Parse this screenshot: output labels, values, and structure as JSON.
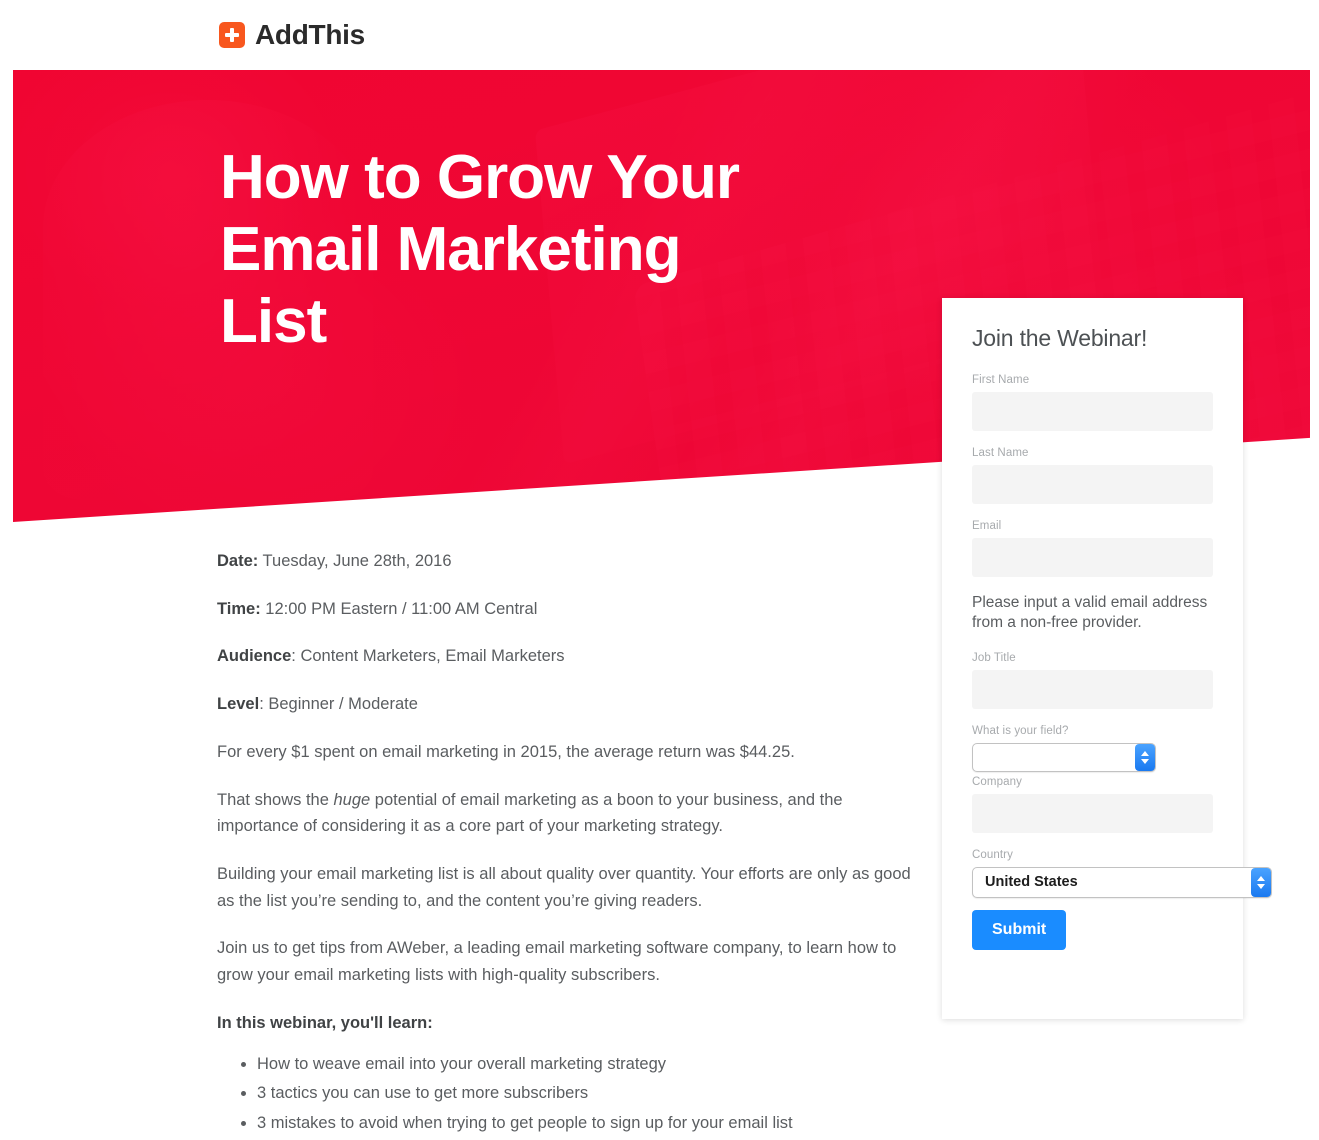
{
  "brand": {
    "name": "AddThis",
    "mark_icon": "addthis-plus-icon",
    "mark_color": "#f8571e"
  },
  "hero": {
    "title": "How to Grow Your\nEmail Marketing\nList",
    "overlay_color": "#ff0844",
    "background_image": "desk-with-laptop-and-drink-photo"
  },
  "article": {
    "meta": [
      {
        "label": "Date:",
        "value": " Tuesday, June 28th, 2016"
      },
      {
        "label": "Time:",
        "value": " 12:00 PM Eastern / 11:00 AM Central"
      },
      {
        "label": "Audience",
        "value": ": Content Marketers, Email Marketers"
      },
      {
        "label": "Level",
        "value": ": Beginner / Moderate"
      }
    ],
    "para_1": "For every $1 spent on email marketing in 2015, the average return was $44.25.",
    "para_2_before": "That shows the ",
    "para_2_em": "huge",
    "para_2_after": " potential of email marketing as a boon to your business, and the importance of considering it as a core part of your marketing strategy.",
    "para_3": "Building your email marketing list is all about quality over quantity. Your efforts are only as good as the list you’re sending to, and the content you’re giving readers.",
    "para_4": "Join us to get tips from AWeber, a leading email marketing software company, to learn how to grow your email marketing lists with high-quality subscribers.",
    "lead_in": "In this webinar, you'll learn:",
    "bullets": [
      "How to weave email into your overall marketing strategy",
      "3 tactics you can use to get more subscribers",
      "3 mistakes to avoid when trying to get people to sign up for your email list"
    ]
  },
  "form": {
    "title": "Join the Webinar!",
    "first_name": {
      "label": "First Name",
      "value": "",
      "placeholder": ""
    },
    "last_name": {
      "label": "Last Name",
      "value": "",
      "placeholder": ""
    },
    "email": {
      "label": "Email",
      "value": "",
      "placeholder": ""
    },
    "email_note": "Please input a valid email address from a non-free provider.",
    "job_title": {
      "label": "Job Title",
      "value": "",
      "placeholder": ""
    },
    "field": {
      "label": "What is your field?",
      "value": ""
    },
    "company": {
      "label": "Company",
      "value": "",
      "placeholder": ""
    },
    "country": {
      "label": "Country",
      "value": "United States"
    },
    "submit_label": "Submit",
    "submit_color": "#1a8cff"
  }
}
